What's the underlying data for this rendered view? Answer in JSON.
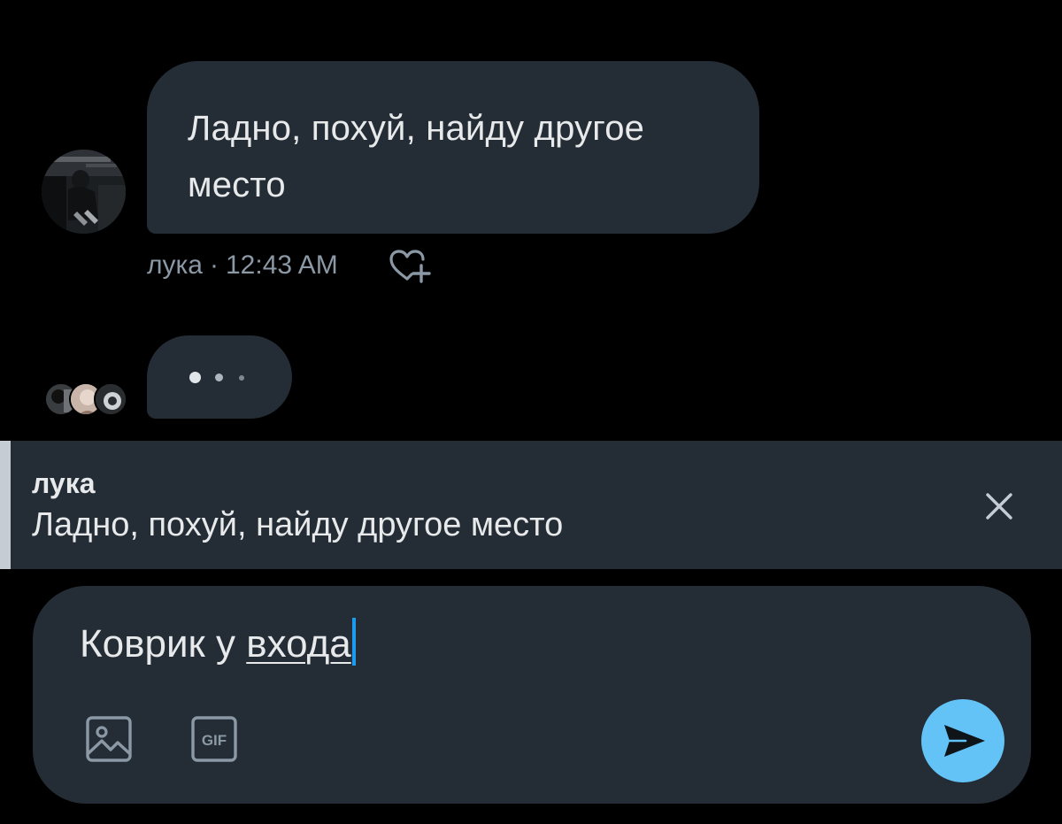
{
  "message": {
    "text": "Ладно, похуй, найду другое место",
    "author": "лука",
    "separator": "·",
    "time": "12:43 AM"
  },
  "reply": {
    "author": "лука",
    "text": "Ладно, похуй, найду другое место"
  },
  "composer": {
    "text_before": "Коврик у ",
    "text_underlined": "входа"
  },
  "icons": {
    "react": "heart-plus-icon",
    "close": "close-icon",
    "image": "image-icon",
    "gif": "gif-icon",
    "send": "send-icon",
    "gif_label": "GIF"
  },
  "colors": {
    "background": "#000000",
    "bubble": "#242d35",
    "text": "#e7e9ea",
    "meta_text": "#8b98a5",
    "caret": "#1d9bf0",
    "send_button": "#63c3f6",
    "reply_accent": "#c5ccd3"
  }
}
